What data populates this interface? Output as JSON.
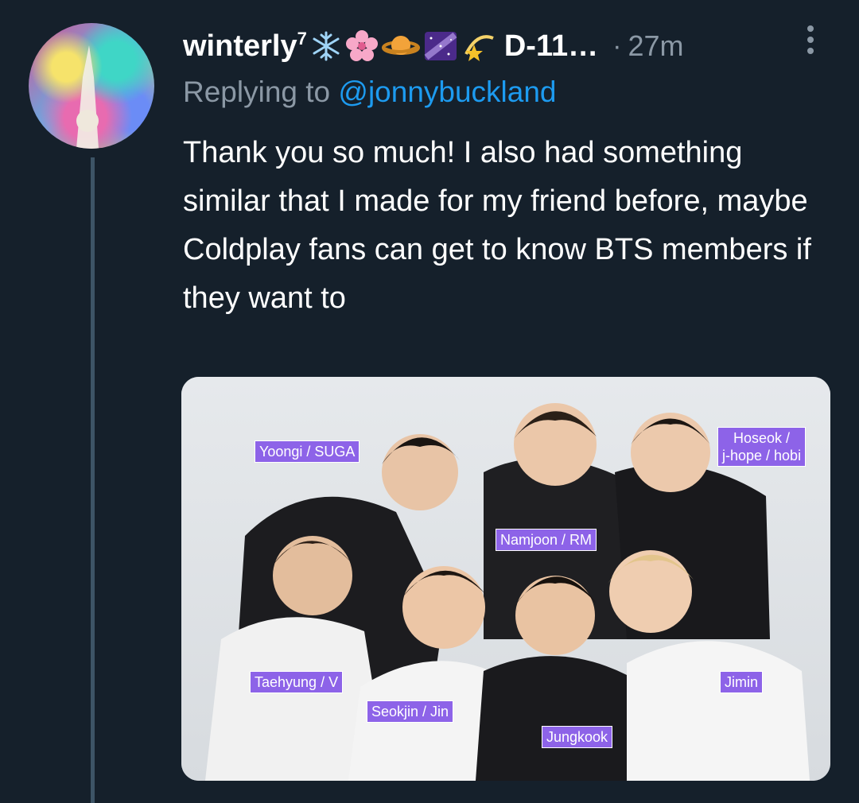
{
  "tweet": {
    "display_name": "winterly",
    "name_superscript": "7",
    "name_emojis": [
      "snowflake-icon",
      "cherry-blossom-icon",
      "ringed-planet-icon",
      "milky-way-icon",
      "shooting-star-icon"
    ],
    "name_suffix": "D-11…",
    "separator": "·",
    "time": "27m",
    "reply_prefix": "Replying to",
    "reply_handle": "@jonnybuckland",
    "text": "Thank you so much! I also had something similar that I made for my friend before, maybe Coldplay fans can get to know BTS members if they want to"
  },
  "photo": {
    "labels": {
      "suga": "Yoongi / SUGA",
      "jhope_line1": "Hoseok /",
      "jhope_line2": "j-hope / hobi",
      "rm": "Namjoon / RM",
      "v": "Taehyung / V",
      "jimin": "Jimin",
      "jin": "Seokjin / Jin",
      "jungkook": "Jungkook"
    },
    "label_color": "#8d63e8"
  },
  "colors": {
    "background": "#15202b",
    "secondary_text": "#8b98a5",
    "link": "#1d9bf0",
    "thread_line": "#3d5466"
  }
}
